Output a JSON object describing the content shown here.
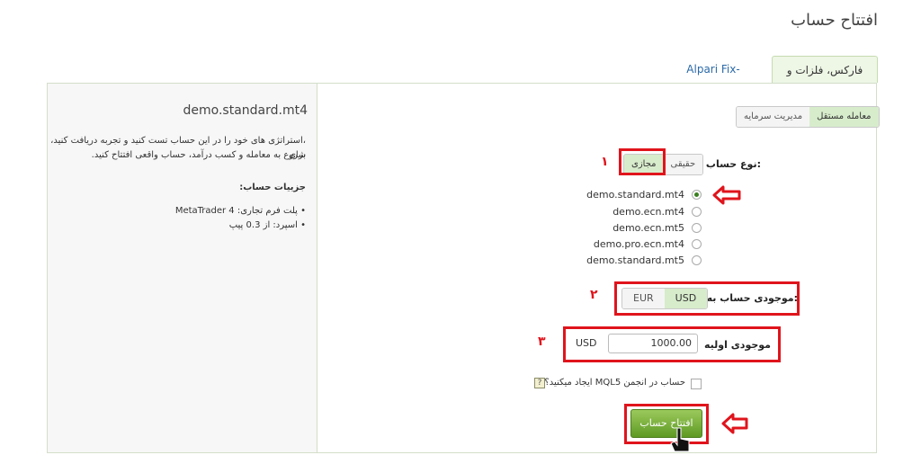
{
  "page": {
    "title": "افتتاح حساب"
  },
  "tabs": [
    {
      "label": "فارکس، فلزات و CFD",
      "active": true
    },
    {
      "label": "Alpari Fix-Contracts",
      "active": false
    }
  ],
  "mode_toggle": {
    "options": [
      "معامله مستقل",
      "مدیریت سرمایه"
    ],
    "selected": "معامله مستقل"
  },
  "account_type": {
    "label": "نوع حساب:",
    "options": [
      "حقیقی",
      "مجازی"
    ],
    "selected": "مجازی",
    "marker": "۱"
  },
  "server_options": [
    {
      "label": "demo.standard.mt4",
      "selected": true
    },
    {
      "label": "demo.ecn.mt4",
      "selected": false
    },
    {
      "label": "demo.ecn.mt5",
      "selected": false
    },
    {
      "label": "demo.pro.ecn.mt4",
      "selected": false
    },
    {
      "label": "demo.standard.mt5",
      "selected": false
    }
  ],
  "currency": {
    "label": "موجودی حساب به:",
    "options": [
      "EUR",
      "USD"
    ],
    "selected": "USD",
    "marker": "۲"
  },
  "initial_balance": {
    "label": "موجودی اولیه",
    "value": "1000.00",
    "unit": "USD",
    "marker": "۳"
  },
  "mql5": {
    "label": "حساب در انجمن MQL5 ایجاد میکنید؟",
    "help": "?",
    "checked": false
  },
  "submit": {
    "label": "افتتاح حساب"
  },
  "sidebar": {
    "title": "demo.standard.mt4",
    "description_1": "،استراتژی های خود را در این حساب تست کنید و تجربه دریافت کنید، برای",
    "description_2": "شروع به معامله و کسب درآمد، حساب واقعی افتتاح کنید.",
    "details_heading": "جزییات حساب:",
    "details": [
      "پلت فرم تجاری: MetaTrader 4",
      "اسپرد: از 0.3 پیپ"
    ]
  },
  "colors": {
    "annotation": "#e0141c",
    "accent_green": "#6fa82f",
    "link_blue": "#2b6aa8"
  }
}
